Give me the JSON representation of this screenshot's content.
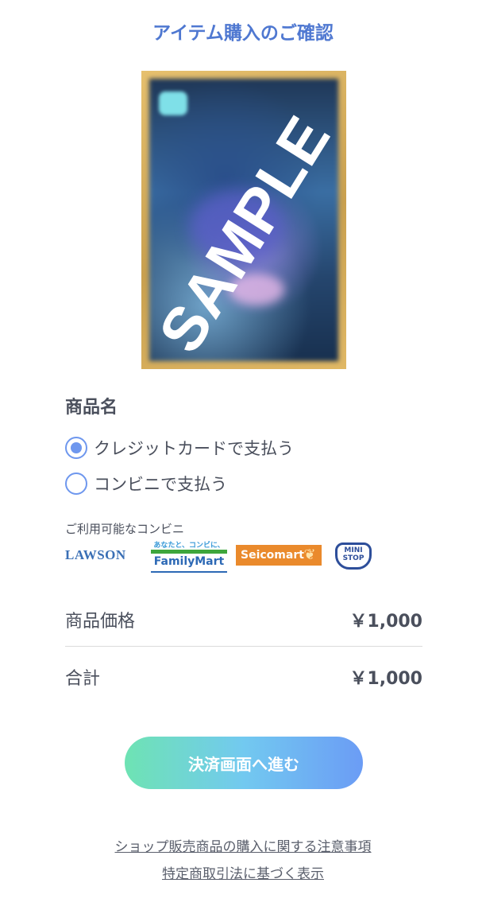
{
  "header": {
    "title": "アイテム購入のご確認"
  },
  "item": {
    "watermark": "SAMPLE",
    "name_label": "商品名"
  },
  "payment": {
    "options": [
      {
        "label": "クレジットカードで支払う",
        "checked": true
      },
      {
        "label": "コンビニで支払う",
        "checked": false
      }
    ],
    "convenience_label": "ご利用可能なコンビニ",
    "stores": {
      "lawson": "LAWSON",
      "familymart_tagline": "あなたと、コンビに、",
      "familymart": "FamilyMart",
      "seicomart": "Seicomart",
      "ministop_line1": "MINI",
      "ministop_line2": "STOP"
    }
  },
  "summary": {
    "price_label": "商品価格",
    "price_value": "￥1,000",
    "total_label": "合計",
    "total_value": "￥1,000"
  },
  "actions": {
    "proceed_label": "決済画面へ進む"
  },
  "footer": {
    "notice_link": "ショップ販売商品の購入に関する注意事項",
    "law_link": "特定商取引法に基づく表示"
  },
  "colors": {
    "title": "#4f78d1",
    "radio": "#6e97ee",
    "button_gradient_start": "#6ee3b3",
    "button_gradient_end": "#6b9cf5"
  }
}
